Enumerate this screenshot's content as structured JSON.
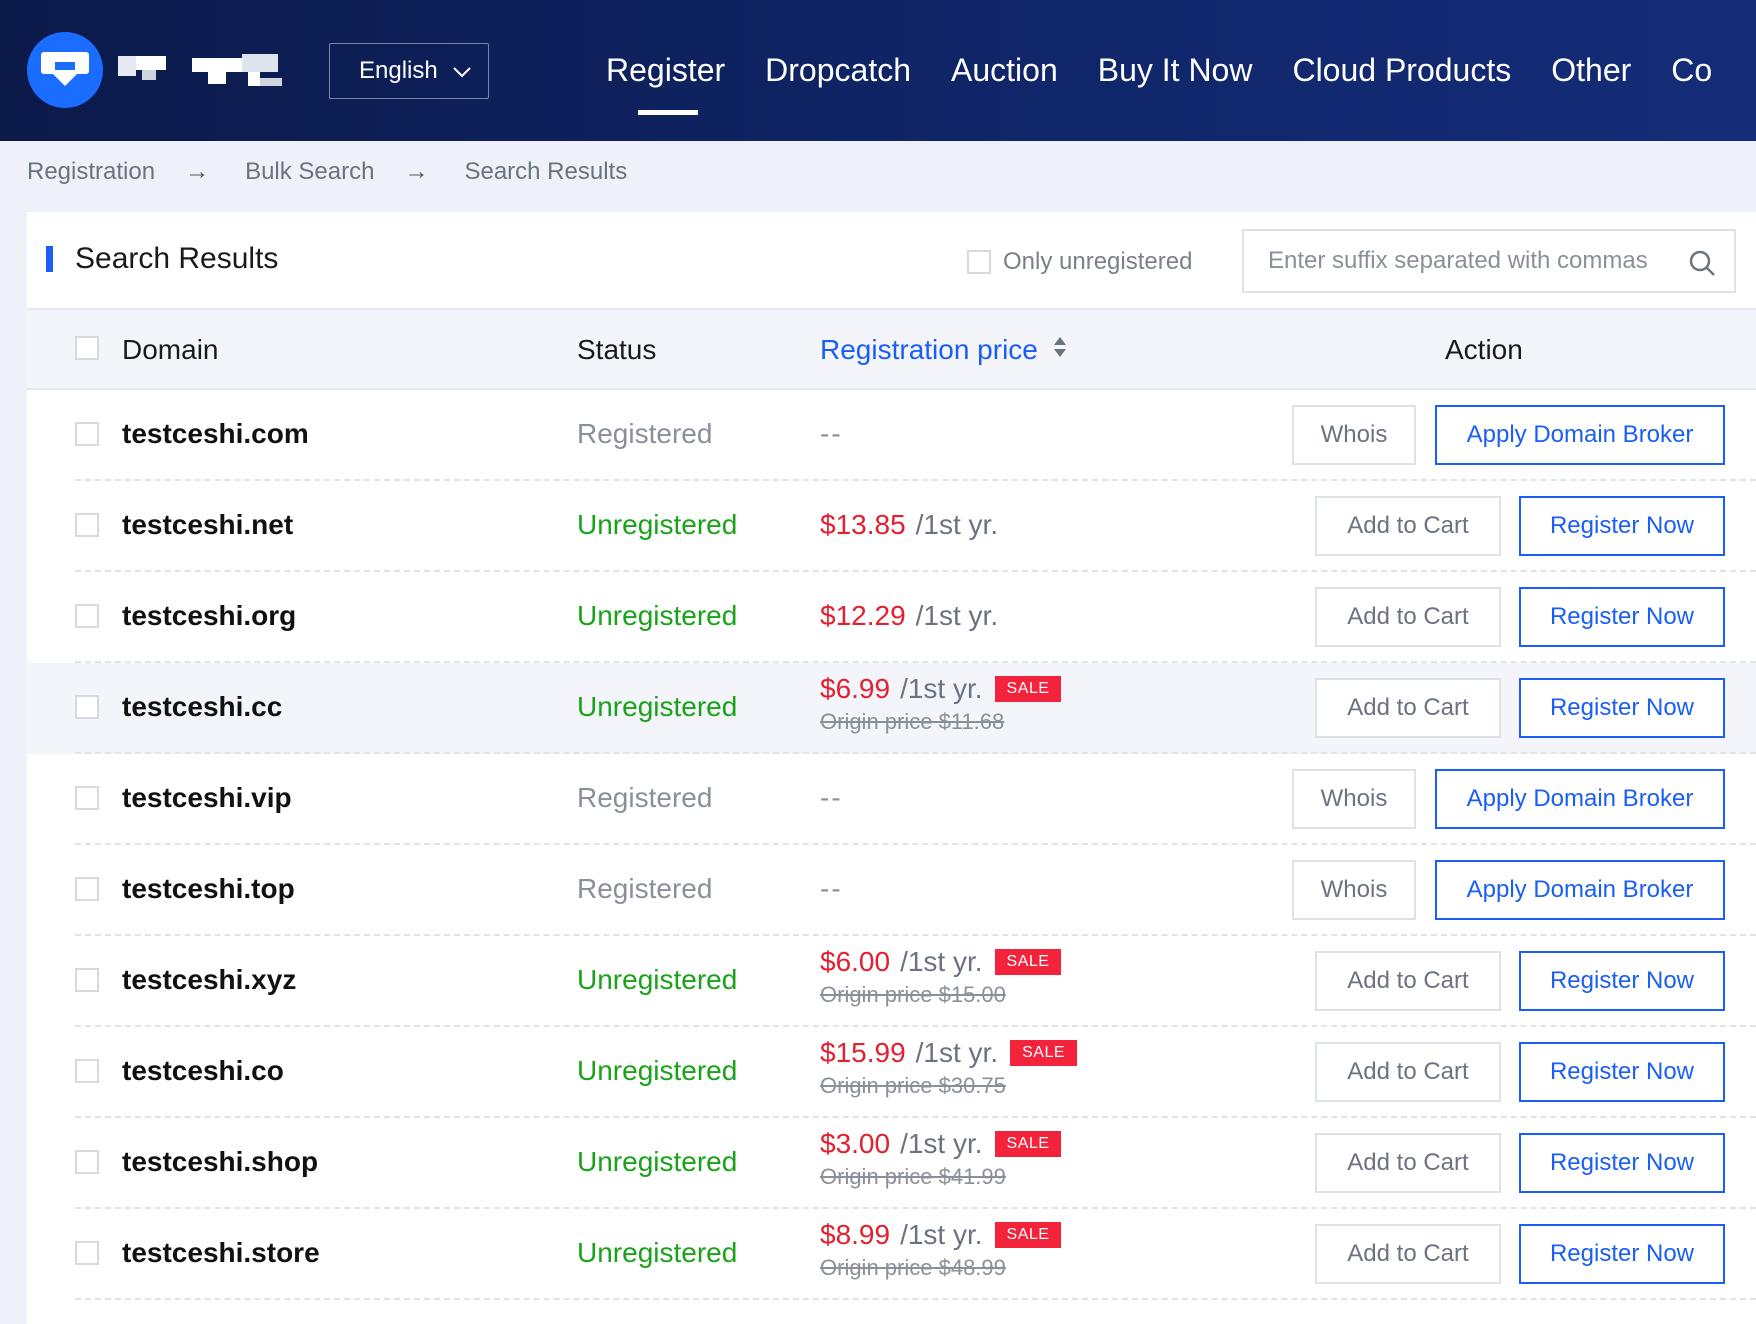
{
  "header": {
    "language": "English",
    "nav": [
      "Register",
      "Dropcatch",
      "Auction",
      "Buy It Now",
      "Cloud Products",
      "Other",
      "Co"
    ]
  },
  "breadcrumb": [
    "Registration",
    "Bulk Search",
    "Search Results"
  ],
  "panel": {
    "title": "Search Results",
    "only_unregistered": "Only unregistered",
    "search_placeholder": "Enter suffix separated with commas"
  },
  "table": {
    "headers": {
      "domain": "Domain",
      "status": "Status",
      "price": "Registration price",
      "action": "Action"
    },
    "rows": [
      {
        "domain": "testceshi.com",
        "status": "Registered",
        "price": "--",
        "per": "",
        "sale": "",
        "origin": "",
        "action1": "Whois",
        "action2": "Apply Domain Broker"
      },
      {
        "domain": "testceshi.net",
        "status": "Unregistered",
        "price": "$13.85",
        "per": "/1st yr.",
        "sale": "",
        "origin": "",
        "action1": "Add to Cart",
        "action2": "Register Now"
      },
      {
        "domain": "testceshi.org",
        "status": "Unregistered",
        "price": "$12.29",
        "per": "/1st yr.",
        "sale": "",
        "origin": "",
        "action1": "Add to Cart",
        "action2": "Register Now"
      },
      {
        "domain": "testceshi.cc",
        "status": "Unregistered",
        "price": "$6.99",
        "per": "/1st yr.",
        "sale": "SALE",
        "origin": "Origin price $11.68",
        "action1": "Add to Cart",
        "action2": "Register Now"
      },
      {
        "domain": "testceshi.vip",
        "status": "Registered",
        "price": "--",
        "per": "",
        "sale": "",
        "origin": "",
        "action1": "Whois",
        "action2": "Apply Domain Broker"
      },
      {
        "domain": "testceshi.top",
        "status": "Registered",
        "price": "--",
        "per": "",
        "sale": "",
        "origin": "",
        "action1": "Whois",
        "action2": "Apply Domain Broker"
      },
      {
        "domain": "testceshi.xyz",
        "status": "Unregistered",
        "price": "$6.00",
        "per": "/1st yr.",
        "sale": "SALE",
        "origin": "Origin price $15.00",
        "action1": "Add to Cart",
        "action2": "Register Now"
      },
      {
        "domain": "testceshi.co",
        "status": "Unregistered",
        "price": "$15.99",
        "per": "/1st yr.",
        "sale": "SALE",
        "origin": "Origin price $30.75",
        "action1": "Add to Cart",
        "action2": "Register Now"
      },
      {
        "domain": "testceshi.shop",
        "status": "Unregistered",
        "price": "$3.00",
        "per": "/1st yr.",
        "sale": "SALE",
        "origin": "Origin price $41.99",
        "action1": "Add to Cart",
        "action2": "Register Now"
      },
      {
        "domain": "testceshi.store",
        "status": "Unregistered",
        "price": "$8.99",
        "per": "/1st yr.",
        "sale": "SALE",
        "origin": "Origin price $48.99",
        "action1": "Add to Cart",
        "action2": "Register Now"
      }
    ]
  },
  "colors": {
    "header_bg": "#0c1a4a",
    "accent": "#1a5ef5",
    "price": "#e2202f",
    "unregistered": "#1aa31a",
    "sale_badge": "#f2233b"
  },
  "icons": [
    "logo-icon",
    "chevron-down-icon",
    "search-icon",
    "sort-icon"
  ]
}
